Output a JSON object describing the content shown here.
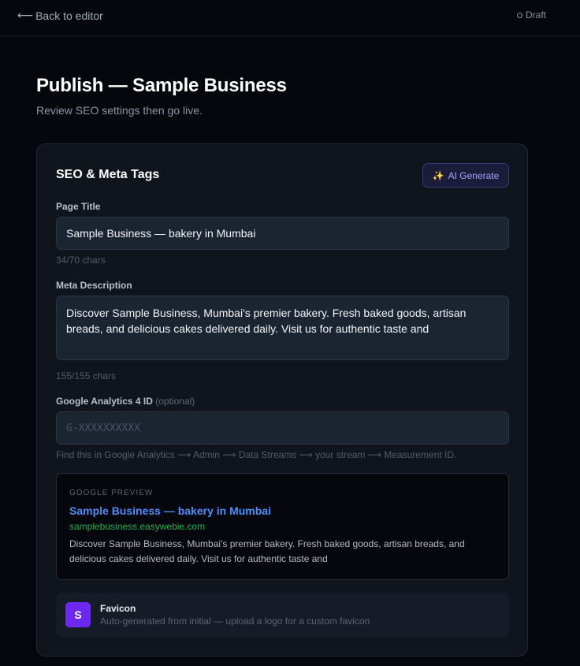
{
  "topbar": {
    "back_arrow": "⟵",
    "back_label": "Back to editor",
    "status_label": "Draft"
  },
  "header": {
    "title": "Publish — Sample Business",
    "subtitle": "Review SEO settings then go live."
  },
  "seo": {
    "title": "SEO & Meta Tags",
    "ai_button_icon": "✨",
    "ai_button_label": "AI Generate",
    "page_title": {
      "label": "Page Title",
      "value": "Sample Business — bakery in Mumbai",
      "counter": "34/70 chars"
    },
    "meta_description": {
      "label": "Meta Description",
      "value": "Discover Sample Business, Mumbai's premier bakery. Fresh baked goods, artisan breads, and delicious cakes delivered daily. Visit us for authentic taste and",
      "counter": "155/155 chars"
    },
    "analytics": {
      "label": "Google Analytics 4 ID",
      "optional": "(optional)",
      "placeholder": "G-XXXXXXXXXX",
      "hint": "Find this in Google Analytics ⟶ Admin ⟶ Data Streams ⟶ your stream ⟶ Measurement ID."
    },
    "preview": {
      "label": "GOOGLE PREVIEW",
      "title": "Sample Business — bakery in Mumbai",
      "url": "samplebusiness.easywebie.com",
      "description": "Discover Sample Business, Mumbai's premier bakery. Fresh baked goods, artisan breads, and delicious cakes delivered daily. Visit us for authentic taste and"
    },
    "favicon": {
      "initial": "S",
      "title": "Favicon",
      "subtitle": "Auto-generated from initial — upload a logo for a custom favicon"
    }
  },
  "colors": {
    "background": "#05070d",
    "card": "#0f141d",
    "accent": "#6d28f0",
    "link": "#4f8ef7",
    "url_green": "#24b04f"
  }
}
